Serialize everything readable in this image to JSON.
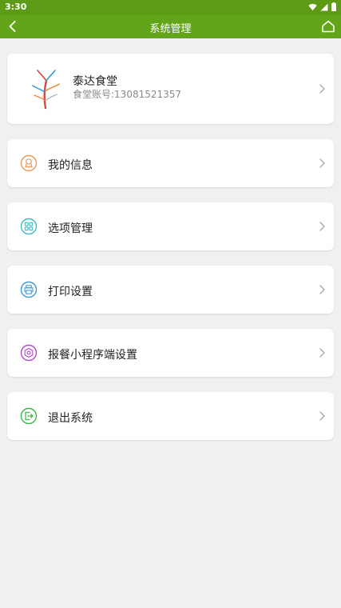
{
  "status_bar": {
    "time": "3:30"
  },
  "app_bar": {
    "title": "系统管理"
  },
  "profile": {
    "name": "泰达食堂",
    "account": "食堂账号:13081521357"
  },
  "menu": [
    {
      "label": "我的信息",
      "icon": "user-badge-icon",
      "color": "#e49a5c"
    },
    {
      "label": "选项管理",
      "icon": "grid-options-icon",
      "color": "#3bbcc3"
    },
    {
      "label": "打印设置",
      "icon": "printer-icon",
      "color": "#3f9ad8"
    },
    {
      "label": "报餐小程序端设置",
      "icon": "gear-icon",
      "color": "#b548cc"
    },
    {
      "label": "退出系统",
      "icon": "logout-icon",
      "color": "#3cb54a"
    }
  ],
  "colors": {
    "app_bar": "#63a519",
    "status_bar": "#5d9b17",
    "background": "#f0f0f0"
  }
}
